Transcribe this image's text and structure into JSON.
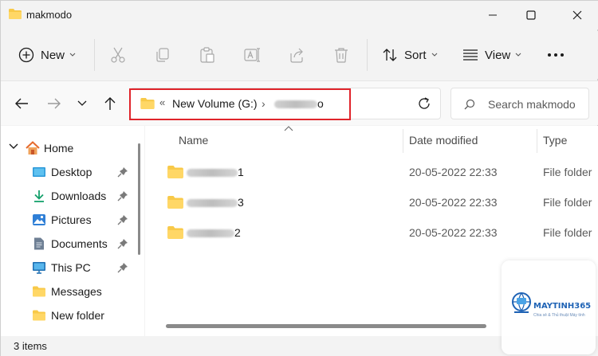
{
  "window": {
    "title": "makmodo"
  },
  "commands": {
    "new_label": "New",
    "sort_label": "Sort",
    "view_label": "View",
    "icons": [
      "cut-icon",
      "copy-icon",
      "paste-icon",
      "rename-icon",
      "share-icon",
      "delete-icon"
    ]
  },
  "address": {
    "overflow": "«",
    "segments": [
      "New Volume (G:)",
      "o"
    ],
    "separator": "›"
  },
  "search": {
    "placeholder": "Search makmodo"
  },
  "nav": {
    "home": "Home",
    "items": [
      {
        "label": "Desktop",
        "icon": "desktop-icon",
        "pinned": true
      },
      {
        "label": "Downloads",
        "icon": "download-icon",
        "pinned": true
      },
      {
        "label": "Pictures",
        "icon": "pictures-icon",
        "pinned": true
      },
      {
        "label": "Documents",
        "icon": "documents-icon",
        "pinned": true
      },
      {
        "label": "This PC",
        "icon": "pc-icon",
        "pinned": true
      },
      {
        "label": "Messages",
        "icon": "folder-icon",
        "pinned": false
      },
      {
        "label": "New folder",
        "icon": "folder-icon",
        "pinned": false
      }
    ]
  },
  "columns": {
    "name": "Name",
    "date": "Date modified",
    "type": "Type"
  },
  "files": [
    {
      "name_suffix": "1",
      "date": "20-05-2022 22:33",
      "type": "File folder"
    },
    {
      "name_suffix": "3",
      "date": "20-05-2022 22:33",
      "type": "File folder"
    },
    {
      "name_suffix": "2",
      "date": "20-05-2022 22:33",
      "type": "File folder"
    }
  ],
  "status": {
    "count": "3 items"
  },
  "watermark": {
    "name": "MAYTINH365",
    "tagline": "Chia sẻ & Thủ thuật Máy tính"
  },
  "colors": {
    "folder": "#f8c948",
    "accent": "#0067c0",
    "highlight_box": "#e0242b"
  }
}
